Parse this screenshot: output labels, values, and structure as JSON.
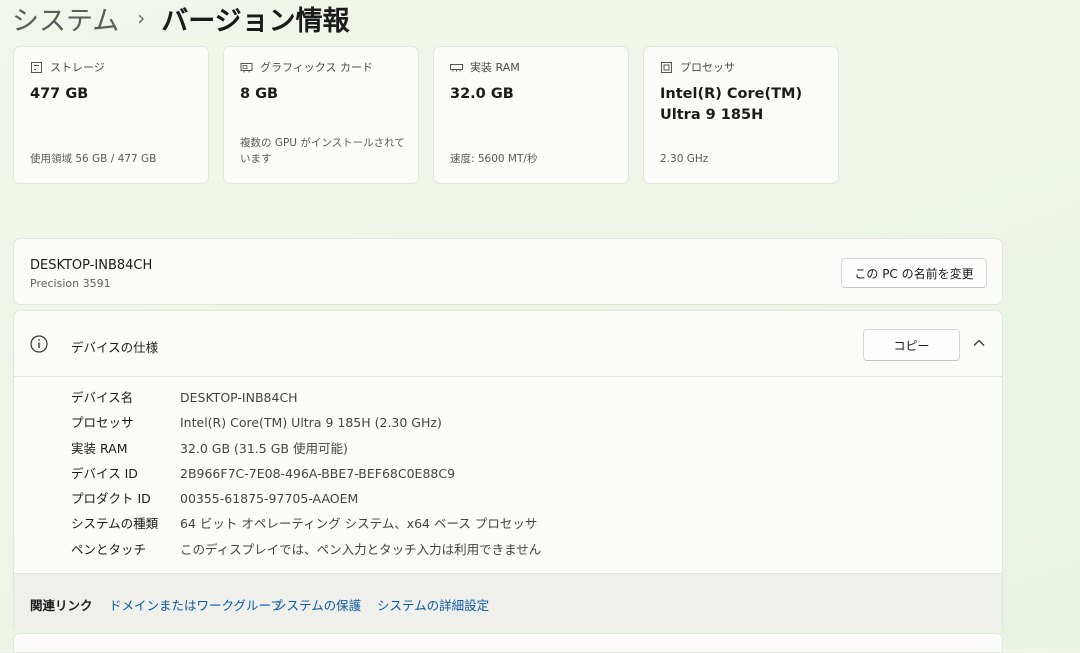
{
  "breadcrumb": {
    "parent": "システム",
    "separator": "›",
    "current": "バージョン情報"
  },
  "cards": [
    {
      "icon": "storage-icon",
      "label": "ストレージ",
      "value": "477 GB",
      "sub": "使用領域 56 GB / 477 GB"
    },
    {
      "icon": "graphics-card-icon",
      "label": "グラフィックス カード",
      "value": "8 GB",
      "sub": "複数の GPU がインストールされています"
    },
    {
      "icon": "ram-icon",
      "label": "実装 RAM",
      "value": "32.0 GB",
      "sub": "速度: 5600 MT/秒"
    },
    {
      "icon": "processor-icon",
      "label": "プロセッサ",
      "value": "Intel(R) Core(TM) Ultra 9 185H",
      "sub": "2.30 GHz"
    }
  ],
  "device": {
    "name": "DESKTOP-INB84CH",
    "model": "Precision 3591",
    "rename_label": "この PC の名前を変更"
  },
  "spec": {
    "title": "デバイスの仕様",
    "copy_label": "コピー",
    "rows": [
      {
        "label": "デバイス名",
        "value": "DESKTOP-INB84CH"
      },
      {
        "label": "プロセッサ",
        "value": "Intel(R) Core(TM) Ultra 9 185H (2.30 GHz)"
      },
      {
        "label": "実装 RAM",
        "value": "32.0 GB (31.5 GB 使用可能)"
      },
      {
        "label": "デバイス ID",
        "value": "2B966F7C-7E08-496A-BBE7-BEF68C0E88C9"
      },
      {
        "label": "プロダクト ID",
        "value": "00355-61875-97705-AAOEM"
      },
      {
        "label": "システムの種類",
        "value": "64 ビット オペレーティング システム、x64 ベース プロセッサ"
      },
      {
        "label": "ペンとタッチ",
        "value": "このディスプレイでは、ペン入力とタッチ入力は利用できません"
      }
    ]
  },
  "related": {
    "title": "関連リンク",
    "links": [
      "ドメインまたはワークグループ",
      "システムの保護",
      "システムの詳細設定"
    ]
  },
  "colors": {
    "link": "#0a5aa8",
    "background": "#eef5e6",
    "card": "#fbfcf9"
  }
}
